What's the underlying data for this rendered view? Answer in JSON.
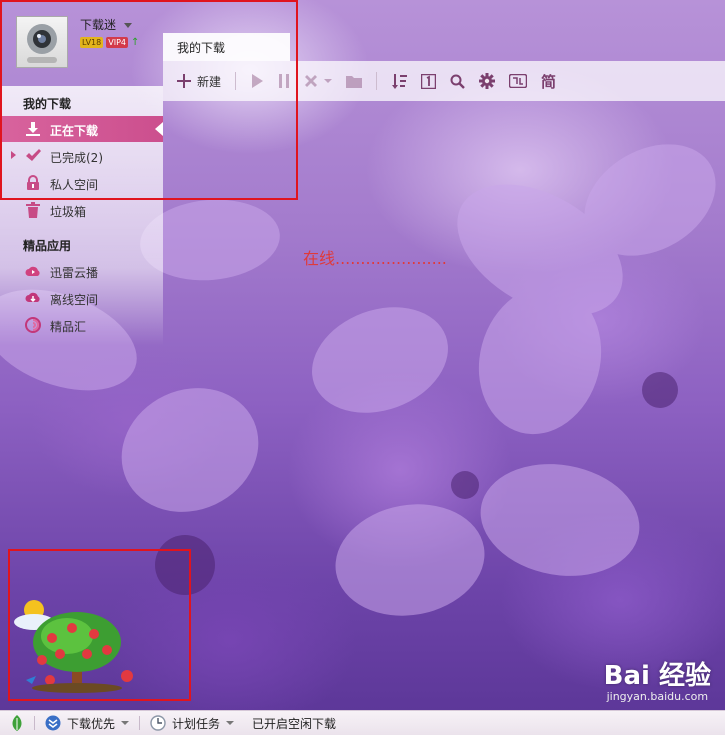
{
  "user": {
    "name": "下载迷",
    "level": "LV18",
    "vip": "VIP4"
  },
  "tabs": [
    {
      "label": "我的下载"
    }
  ],
  "toolbar": {
    "new_label": "新建",
    "simplified_label": "简"
  },
  "sidebar": {
    "section_downloads": "我的下载",
    "items": [
      {
        "label": "正在下载",
        "icon": "download-icon"
      },
      {
        "label": "已完成(2)",
        "icon": "check-icon"
      },
      {
        "label": "私人空间",
        "icon": "lock-icon"
      },
      {
        "label": "垃圾箱",
        "icon": "trash-icon"
      }
    ],
    "section_apps": "精品应用",
    "apps": [
      {
        "label": "迅雷云播",
        "icon": "cloud-play-icon"
      },
      {
        "label": "离线空间",
        "icon": "offline-space-icon"
      },
      {
        "label": "精品汇",
        "icon": "swirl-icon"
      }
    ]
  },
  "main": {
    "status_text": "在线......................"
  },
  "statusbar": {
    "priority_label": "下载优先",
    "schedule_label": "计划任务",
    "idle_text": "已开启空闲下载"
  },
  "watermark": {
    "brand": "Bai 经验",
    "url": "jingyan.baidu.com"
  },
  "colors": {
    "accent": "#cc4f8e",
    "annotation": "#e0141e",
    "online_text": "#e03a3a"
  }
}
